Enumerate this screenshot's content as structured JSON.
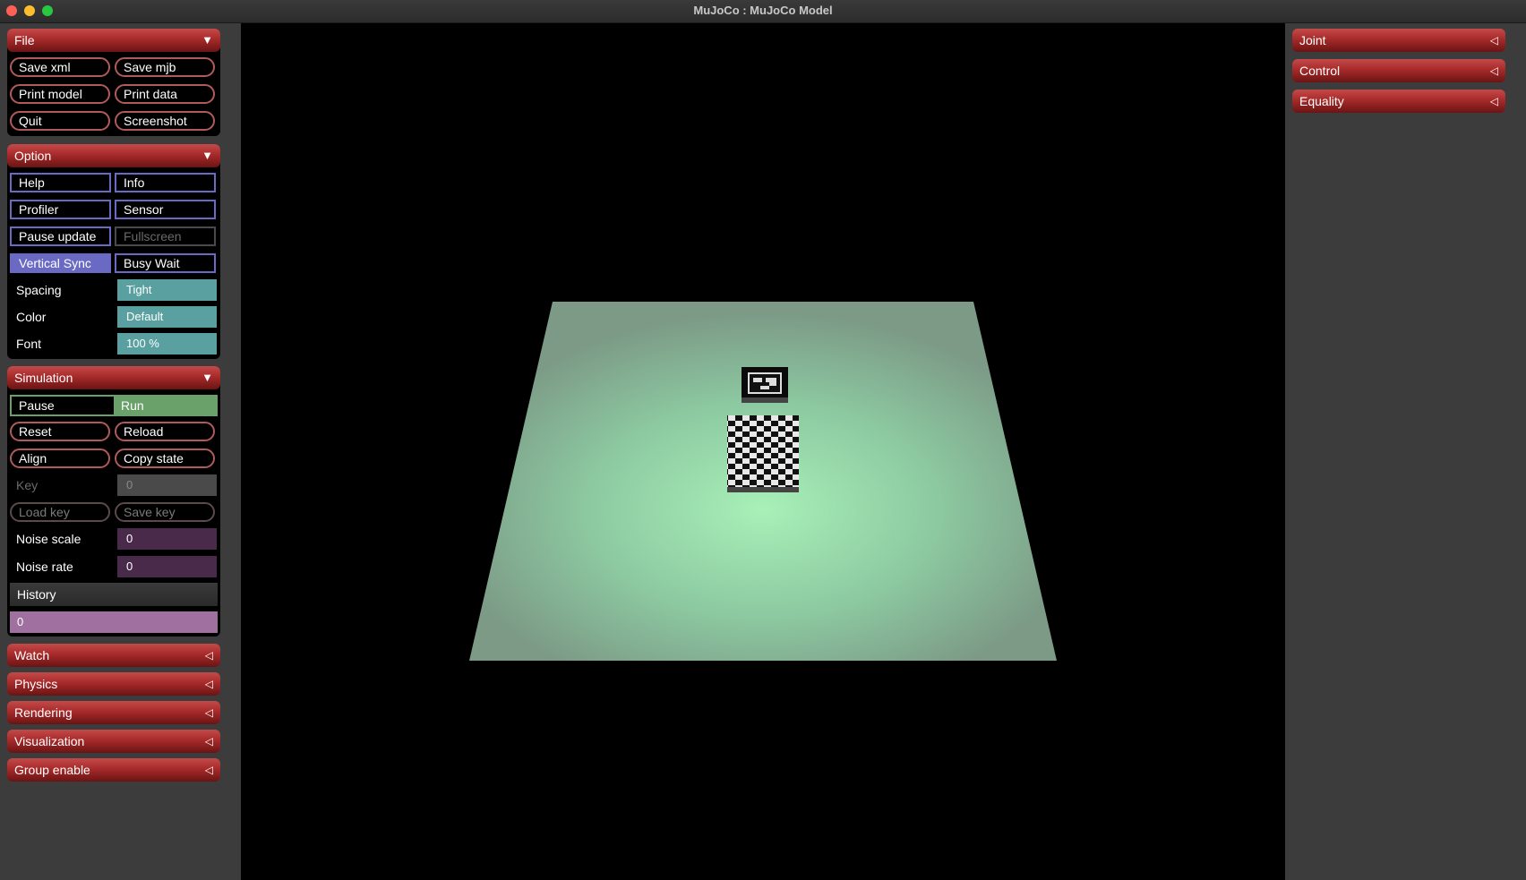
{
  "window": {
    "title": "MuJoCo : MuJoCo Model"
  },
  "icons": {
    "expanded": "▼",
    "collapsed": "◁"
  },
  "file": {
    "header": "File",
    "buttons": [
      "Save xml",
      "Save mjb",
      "Print model",
      "Print data",
      "Quit",
      "Screenshot"
    ]
  },
  "option": {
    "header": "Option",
    "help": "Help",
    "info": "Info",
    "profiler": "Profiler",
    "sensor": "Sensor",
    "pause_update": "Pause update",
    "fullscreen": "Fullscreen",
    "vertical_sync": "Vertical Sync",
    "busy_wait": "Busy Wait",
    "spacing_label": "Spacing",
    "spacing_value": "Tight",
    "color_label": "Color",
    "color_value": "Default",
    "font_label": "Font",
    "font_value": "100 %"
  },
  "simulation": {
    "header": "Simulation",
    "pause": "Pause",
    "run": "Run",
    "reset": "Reset",
    "reload": "Reload",
    "align": "Align",
    "copy_state": "Copy state",
    "key_label": "Key",
    "key_value": "0",
    "load_key": "Load key",
    "save_key": "Save key",
    "noise_scale_label": "Noise scale",
    "noise_scale_value": "0",
    "noise_rate_label": "Noise rate",
    "noise_rate_value": "0",
    "history_label": "History",
    "history_value": "0"
  },
  "left_collapsed": [
    "Watch",
    "Physics",
    "Rendering",
    "Visualization",
    "Group enable"
  ],
  "right_collapsed": [
    "Joint",
    "Control",
    "Equality"
  ]
}
